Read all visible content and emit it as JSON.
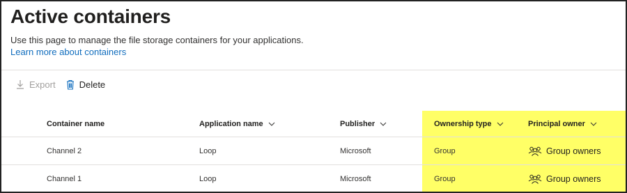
{
  "page": {
    "title": "Active containers",
    "description": "Use this page to manage the file storage containers for your applications.",
    "learn_more": "Learn more about containers"
  },
  "toolbar": {
    "export_label": "Export",
    "export_icon": "download-arrow-icon",
    "delete_label": "Delete",
    "delete_icon": "trash-icon"
  },
  "table": {
    "columns": [
      {
        "label": "Container name",
        "sortable": false
      },
      {
        "label": "Application name",
        "sortable": true
      },
      {
        "label": "Publisher",
        "sortable": true
      },
      {
        "label": "Ownership type",
        "sortable": true
      },
      {
        "label": "Principal owner",
        "sortable": true
      }
    ],
    "rows": [
      {
        "container_name": "Channel 2",
        "application_name": "Loop",
        "publisher": "Microsoft",
        "ownership_type": "Group",
        "principal_owner": "Group owners",
        "owner_icon": "people-group-icon"
      },
      {
        "container_name": "Channel 1",
        "application_name": "Loop",
        "publisher": "Microsoft",
        "ownership_type": "Group",
        "principal_owner": "Group owners",
        "owner_icon": "people-group-icon"
      }
    ]
  },
  "colors": {
    "highlight": "#ffff66",
    "link": "#0f6cbd",
    "disabled_text": "#a19f9d",
    "border": "#e1dfdd"
  }
}
